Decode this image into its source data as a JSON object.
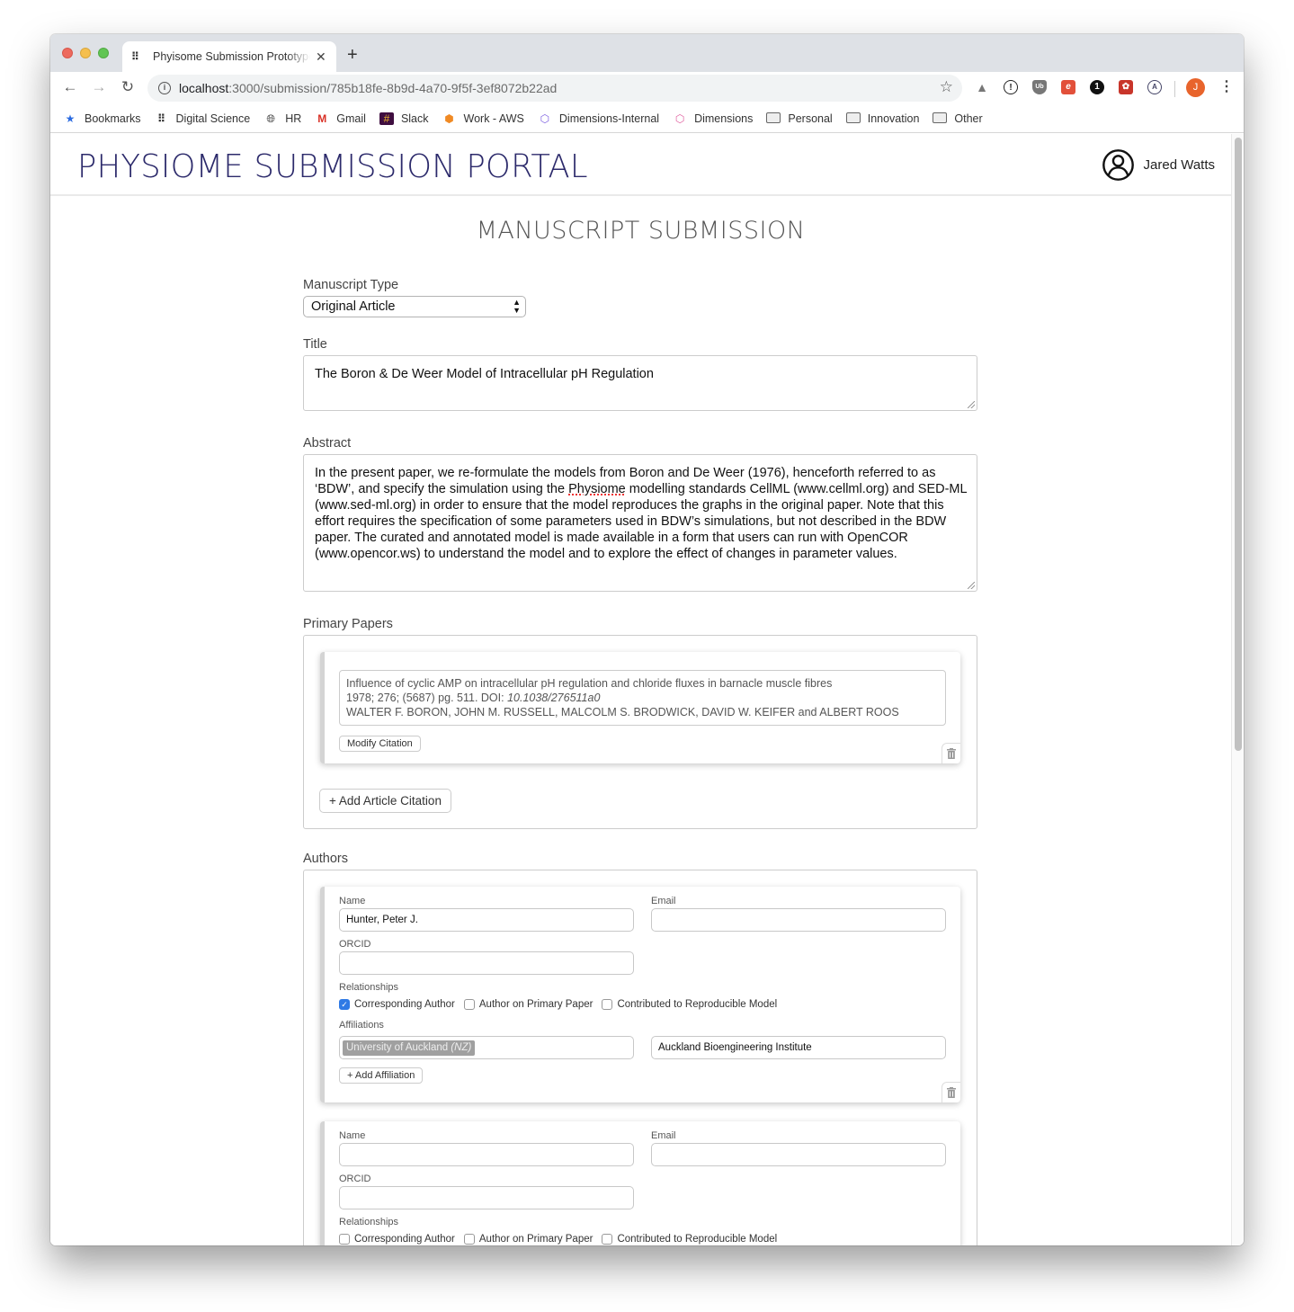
{
  "browser": {
    "tab_title": "Phyisome Submission Prototype",
    "url_host": "localhost",
    "url_path": ":3000/submission/785b18fe-8b9d-4a70-9f5f-3ef8072b22ad",
    "profile_initial": "J",
    "bookmarks": [
      {
        "label": "Bookmarks",
        "icon": "star-icon"
      },
      {
        "label": "Digital Science",
        "icon": "digital-science-icon"
      },
      {
        "label": "HR",
        "icon": "globe-icon"
      },
      {
        "label": "Gmail",
        "icon": "gmail-icon"
      },
      {
        "label": "Slack",
        "icon": "slack-icon"
      },
      {
        "label": "Work - AWS",
        "icon": "aws-cube-icon"
      },
      {
        "label": "Dimensions-Internal",
        "icon": "dimensions-icon"
      },
      {
        "label": "Dimensions",
        "icon": "dimensions-icon"
      },
      {
        "label": "Personal",
        "icon": "folder-icon"
      },
      {
        "label": "Innovation",
        "icon": "folder-icon"
      },
      {
        "label": "Other",
        "icon": "folder-icon"
      }
    ]
  },
  "header": {
    "portal_title": "PHYSIOME SUBMISSION PORTAL",
    "user_name": "Jared Watts"
  },
  "page_heading": "MANUSCRIPT SUBMISSION",
  "form": {
    "manuscript_type": {
      "label": "Manuscript Type",
      "value": "Original Article"
    },
    "title": {
      "label": "Title",
      "value": "The Boron & De Weer Model of Intracellular pH Regulation"
    },
    "abstract": {
      "label": "Abstract",
      "value_before": "In the present paper, we re-formulate the models from Boron and De Weer (1976), henceforth referred to as ‘BDW’, and specify the simulation using the ",
      "value_misspelled": "Physiome",
      "value_after": " modelling standards CellML (www.cellml.org) and SED-ML (www.sed-ml.org) in order to ensure that the model reproduces the graphs in the original paper. Note that this effort requires the specification of some parameters used in BDW’s simulations, but not described in the BDW paper. The curated and annotated model is made available in a form that users can run with OpenCOR (www.opencor.ws) to understand the model and to explore the effect of changes in parameter values."
    },
    "primary_papers": {
      "label": "Primary Papers",
      "citations": [
        {
          "title": "Influence of cyclic AMP on intracellular pH regulation and chloride fluxes in barnacle muscle fibres",
          "details": "1978; 276; (5687) pg. 511. DOI: ",
          "doi": "10.1038/276511a0",
          "authors": "WALTER F. BORON, JOHN M. RUSSELL, MALCOLM S. BRODWICK, DAVID W. KEIFER and ALBERT ROOS",
          "modify_label": "Modify Citation"
        }
      ],
      "add_label": "+ Add Article Citation"
    },
    "authors": {
      "label": "Authors",
      "field_labels": {
        "name": "Name",
        "email": "Email",
        "orcid": "ORCID",
        "relationships": "Relationships",
        "affiliations": "Affiliations"
      },
      "relationship_options": [
        "Corresponding Author",
        "Author on Primary Paper",
        "Contributed to Reproducible Model"
      ],
      "add_affiliation_label": "+ Add Affiliation",
      "list": [
        {
          "name": "Hunter, Peter J.",
          "email": "",
          "orcid": "",
          "relationships": [
            true,
            false,
            false
          ],
          "affiliation_org": "University of Auckland",
          "affiliation_country": "(NZ)",
          "affiliation_dept": "Auckland Bioengineering Institute"
        },
        {
          "name": "",
          "email": "",
          "orcid": "",
          "relationships": [
            false,
            false,
            false
          ]
        }
      ]
    }
  }
}
